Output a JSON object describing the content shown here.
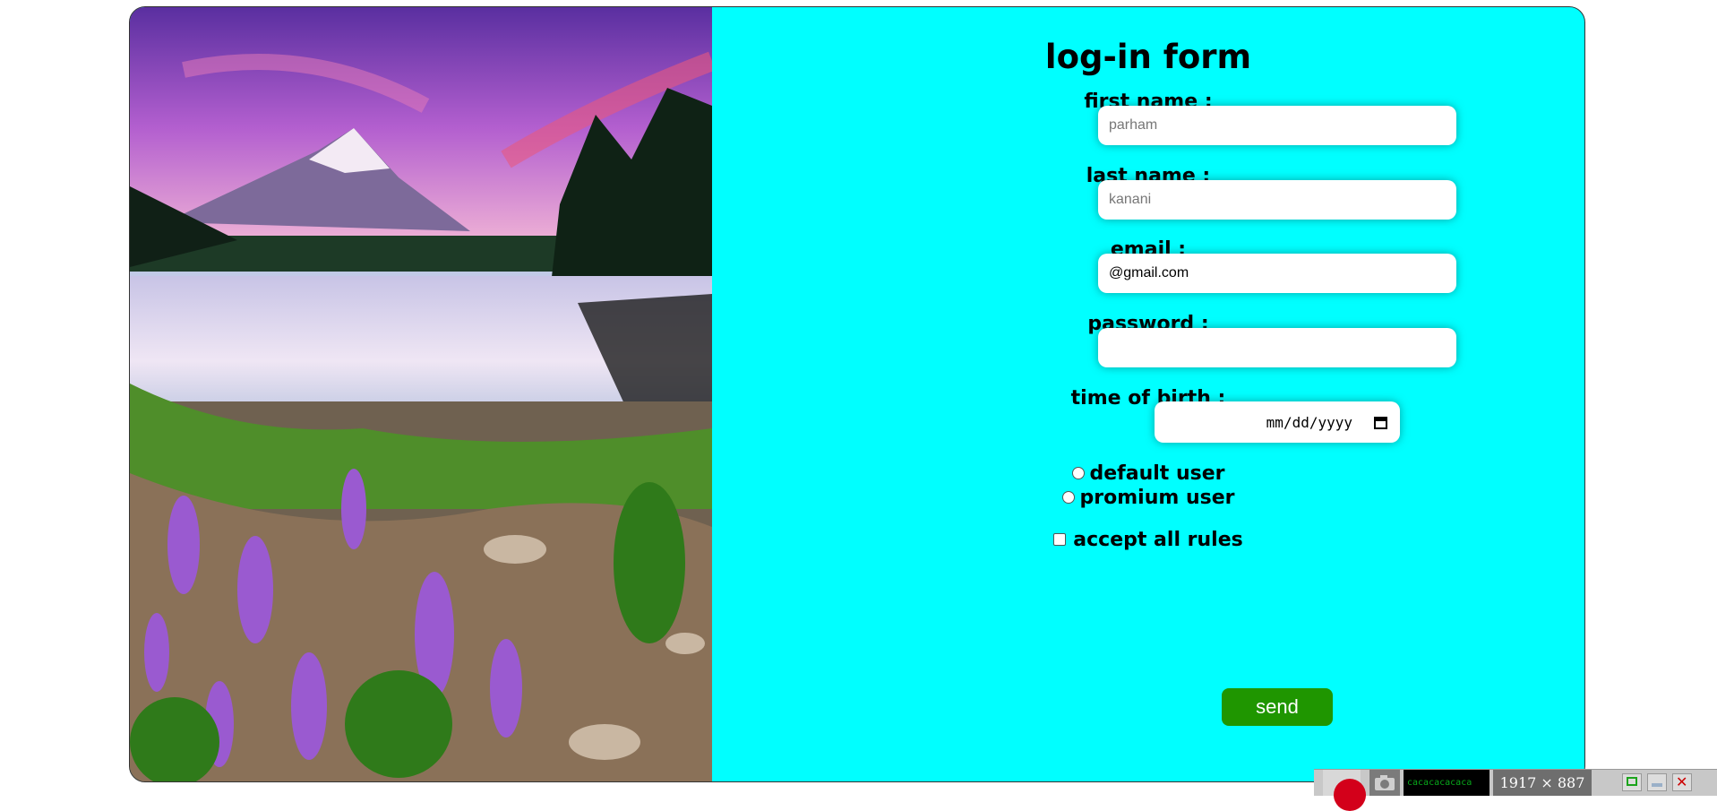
{
  "form": {
    "title": "log-in form",
    "first_name": {
      "label": "first name :",
      "placeholder": "parham",
      "value": ""
    },
    "last_name": {
      "label": "last name :",
      "placeholder": "kanani",
      "value": ""
    },
    "email": {
      "label": "email :",
      "placeholder": "",
      "value": "@gmail.com"
    },
    "password": {
      "label": "password :",
      "placeholder": "",
      "value": ""
    },
    "birth": {
      "label": "time of birth :",
      "placeholder": "mm/dd/yyyy"
    },
    "radio_options": [
      "default user",
      "promium user"
    ],
    "accept_label": "accept all rules",
    "send_label": "send"
  },
  "taskbar": {
    "resolution": "1917 × 887",
    "term_text": "cacacacacaca"
  },
  "colors": {
    "panel_bg": "#00ffff",
    "send_bg": "#1f9600"
  }
}
